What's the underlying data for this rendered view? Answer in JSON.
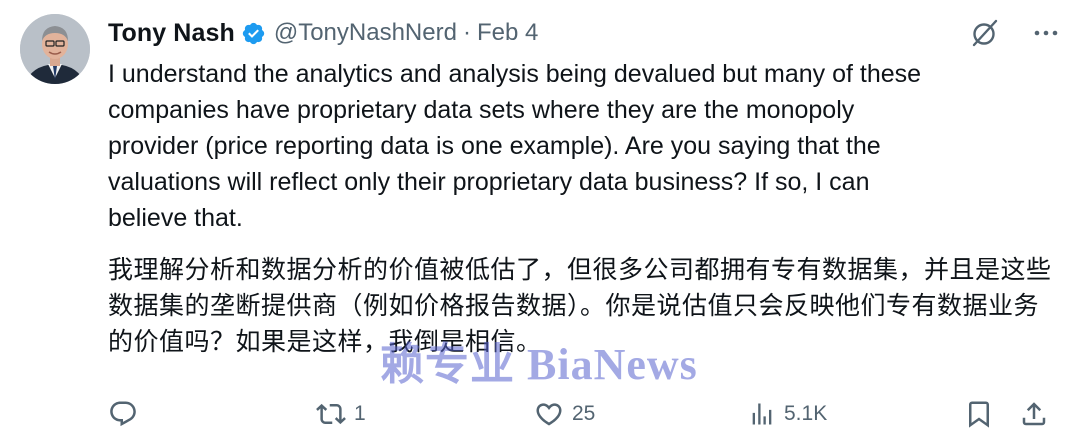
{
  "author": {
    "name": "Tony Nash",
    "handle": "@TonyNashNerd",
    "separator": "·",
    "date": "Feb 4"
  },
  "tweet": {
    "text_en": "I understand the analytics and analysis being devalued but many of these\ncompanies have proprietary data sets where they are the monopoly\nprovider (price reporting data is one example). Are you saying that the\nvaluations will reflect only their proprietary data business? If so, I can\nbelieve that.",
    "text_cn": "我理解分析和数据分析的价值被低估了，但很多公司都拥有专有数据集，并且是这些数据集的垄断提供商（例如价格报告数据）。你是说估值只会反映他们专有数据业务的价值吗？如果是这样，我倒是相信。"
  },
  "watermark": {
    "text": "赖专业 BiaNews"
  },
  "metrics": {
    "replies": "",
    "retweets": "1",
    "likes": "25",
    "views": "5.1K"
  },
  "icons": {
    "verified": "verified-badge-icon",
    "grok": "grok-icon",
    "more": "more-icon",
    "reply": "reply-icon",
    "retweet": "retweet-icon",
    "like": "heart-icon",
    "views": "views-icon",
    "bookmark": "bookmark-icon",
    "share": "share-icon"
  },
  "colors": {
    "text": "#0f1419",
    "secondary": "#536471",
    "verified": "#1d9bf0",
    "watermark": "#5862ce"
  }
}
